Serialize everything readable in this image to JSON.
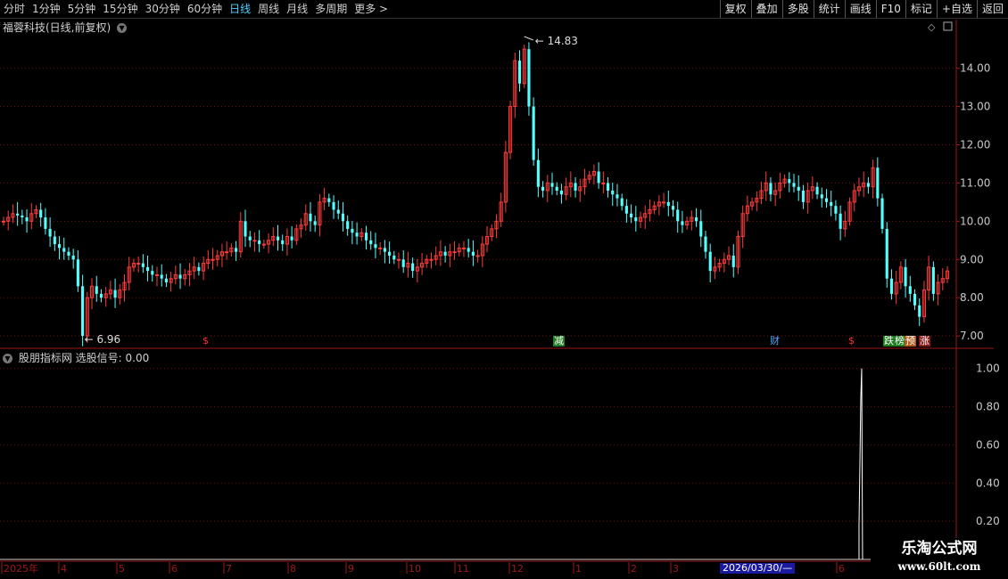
{
  "toolbar": {
    "periods": [
      "分时",
      "1分钟",
      "5分钟",
      "15分钟",
      "30分钟",
      "60分钟",
      "日线",
      "周线",
      "月线",
      "多周期",
      "更多 >"
    ],
    "active_period": "日线",
    "actions": [
      "复权",
      "叠加",
      "多股",
      "统计",
      "画线",
      "F10",
      "标记",
      "+自选",
      "返回"
    ]
  },
  "main_panel": {
    "title": "福蓉科技(日线,前复权)",
    "high_label": "14.83",
    "low_label": "6.96"
  },
  "indicator_panel": {
    "title": "股朋指标网 选股信号: 0.00"
  },
  "signals": [
    {
      "text": "$",
      "color": "#ff3030",
      "bg": ""
    },
    {
      "text": "减",
      "color": "#ffffff",
      "bg": "#1e7b1e"
    },
    {
      "text": "财",
      "color": "#4fa8ff",
      "bg": ""
    },
    {
      "text": "$",
      "color": "#ff3030",
      "bg": ""
    },
    {
      "text": "跌",
      "color": "#ffffff",
      "bg": "#1e7b1e"
    },
    {
      "text": "榜",
      "color": "#ffffff",
      "bg": "#1e7b1e"
    },
    {
      "text": "预",
      "color": "#ffffff",
      "bg": "#b05a1a"
    },
    {
      "text": "涨",
      "color": "#ffffff",
      "bg": "#8a1a1a"
    }
  ],
  "timeline": {
    "labels": [
      "2025年",
      "4",
      "5",
      "6",
      "7",
      "8",
      "9",
      "10",
      "11",
      "12",
      "1",
      "2",
      "3",
      "6"
    ],
    "cursor_date": "2026/03/30/—"
  },
  "watermark": {
    "line1": "乐淘公式网",
    "line2": "www.60lt.com"
  },
  "colors": {
    "up": "#ff3c3c",
    "down": "#54ffff",
    "grid": "#7a1010",
    "axis": "#a01818",
    "text": "#c8c8c8"
  },
  "chart_data": [
    {
      "type": "candlestick",
      "title": "福蓉科技(日线,前复权)",
      "y_ticks": [
        7.0,
        8.0,
        9.0,
        10.0,
        11.0,
        12.0,
        13.0,
        14.0
      ],
      "ylim": [
        6.7,
        14.9
      ],
      "annotations": [
        {
          "label": "14.83",
          "value": 14.83
        },
        {
          "label": "6.96",
          "value": 6.96
        }
      ],
      "close": [
        10.0,
        10.1,
        10.2,
        10.15,
        10.1,
        10.0,
        10.2,
        10.3,
        10.1,
        9.8,
        9.6,
        9.4,
        9.3,
        9.2,
        9.1,
        9.0,
        8.3,
        7.0,
        8.0,
        8.3,
        8.1,
        8.0,
        8.1,
        8.2,
        8.0,
        8.2,
        8.4,
        8.8,
        8.9,
        8.9,
        8.8,
        8.7,
        8.6,
        8.6,
        8.5,
        8.4,
        8.5,
        8.6,
        8.5,
        8.6,
        8.7,
        8.8,
        8.7,
        8.9,
        9.0,
        9.0,
        9.1,
        9.2,
        9.2,
        9.3,
        9.2,
        10.0,
        9.6,
        9.5,
        9.5,
        9.4,
        9.4,
        9.5,
        9.6,
        9.5,
        9.4,
        9.6,
        9.5,
        9.8,
        9.9,
        10.2,
        10.0,
        9.9,
        10.5,
        10.6,
        10.5,
        10.3,
        10.2,
        10.0,
        9.8,
        9.7,
        9.6,
        9.7,
        9.5,
        9.4,
        9.3,
        9.3,
        9.2,
        9.1,
        9.0,
        9.0,
        8.8,
        8.9,
        8.7,
        8.8,
        8.9,
        9.0,
        9.0,
        9.1,
        9.2,
        9.1,
        9.2,
        9.2,
        9.3,
        9.3,
        9.2,
        9.1,
        9.1,
        9.4,
        9.6,
        9.8,
        10.0,
        10.5,
        11.8,
        13.0,
        14.2,
        13.6,
        14.5,
        13.0,
        11.6,
        10.9,
        10.8,
        11.0,
        10.9,
        10.8,
        10.7,
        10.9,
        11.0,
        10.8,
        10.9,
        11.1,
        11.2,
        11.3,
        11.0,
        11.0,
        10.8,
        10.7,
        10.6,
        10.4,
        10.2,
        10.1,
        10.0,
        10.1,
        10.2,
        10.3,
        10.4,
        10.5,
        10.5,
        10.4,
        10.3,
        10.0,
        9.9,
        10.0,
        10.1,
        10.0,
        9.6,
        9.2,
        8.7,
        8.8,
        8.9,
        9.0,
        9.1,
        8.8,
        9.6,
        10.2,
        10.4,
        10.5,
        10.6,
        10.8,
        11.0,
        10.7,
        10.8,
        11.0,
        11.1,
        11.0,
        10.9,
        10.8,
        10.5,
        10.8,
        10.9,
        10.7,
        10.6,
        10.5,
        10.4,
        10.2,
        9.8,
        10.0,
        10.5,
        10.8,
        10.9,
        11.0,
        10.9,
        11.4,
        10.6,
        9.8,
        8.5,
        8.1,
        8.4,
        8.8,
        8.3,
        8.1,
        7.8,
        7.5,
        8.2,
        8.8,
        8.1,
        8.4,
        8.5,
        8.7
      ],
      "signal": {
        "type": "line",
        "ylim": [
          0,
          1.05
        ],
        "y_ticks": [
          0.2,
          0.4,
          0.6,
          0.8,
          1.0
        ],
        "value": 0.0,
        "spike_at_index": 184,
        "spike_value": 1.0
      }
    }
  ]
}
